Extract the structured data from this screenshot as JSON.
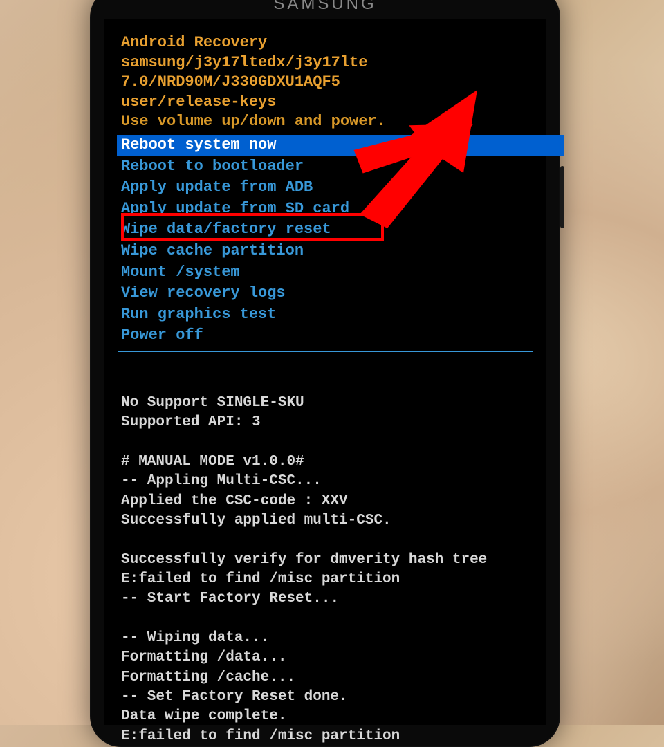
{
  "brand": "SAMSUNG",
  "header": {
    "title": "Android Recovery",
    "device_line": "samsung/j3y17ltedx/j3y17lte",
    "build_line": "7.0/NRD90M/J330GDXU1AQF5",
    "keys_line": "user/release-keys",
    "instruction": "Use volume up/down and power."
  },
  "menu": {
    "selected_index": 0,
    "items": [
      "Reboot system now",
      "Reboot to bootloader",
      "Apply update from ADB",
      "Apply update from SD card",
      "Wipe data/factory reset",
      "Wipe cache partition",
      "Mount /system",
      "View recovery logs",
      "Run graphics test",
      "Power off"
    ]
  },
  "log": {
    "lines": [
      "No Support SINGLE-SKU",
      "Supported API: 3",
      "",
      "# MANUAL MODE v1.0.0#",
      "-- Appling Multi-CSC...",
      "Applied the CSC-code : XXV",
      "Successfully applied multi-CSC.",
      "",
      "Successfully verify for dmverity hash tree",
      "E:failed to find /misc partition",
      "-- Start Factory Reset...",
      "",
      "-- Wiping data...",
      "Formatting /data...",
      "Formatting /cache...",
      "-- Set Factory Reset done.",
      "Data wipe complete.",
      "E:failed to find /misc partition"
    ]
  },
  "annotation": {
    "highlighted_item_index": 4
  }
}
